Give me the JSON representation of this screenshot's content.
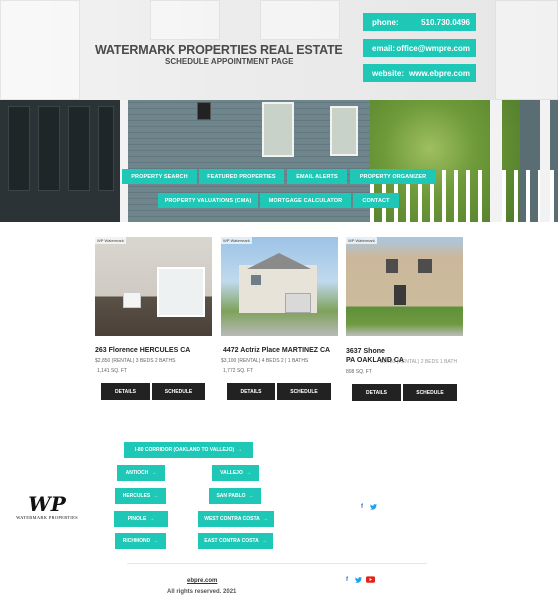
{
  "header": {
    "title": "WATERMARK PROPERTIES REAL ESTATE",
    "subtitle": "SCHEDULE APPOINTMENT PAGE",
    "phone_label": "phone:",
    "phone_value": "510.730.0496",
    "email_label": "email:",
    "email_value": "office@wmpre.com",
    "website_label": "website:",
    "website_value": "www.ebpre.com"
  },
  "nav": {
    "items": [
      "PROPERTY SEARCH",
      "FEATURED PROPERTIES",
      "EMAIL ALERTS",
      "PROPERTY ORGANIZER",
      "PROPERTY VALUATIONS (CMA)",
      "MORTGAGE CALCULATOR",
      "CONTACT"
    ]
  },
  "listings": [
    {
      "logo_text": "WP Watermark",
      "address": "263 Florence HERCULES CA",
      "details_line": "$2,850 (RENTAL) 3 BEDS 2 BATHS",
      "sqft": "1,141 SQ. FT",
      "details_label": "DETAILS",
      "schedule_label": "SCHEDULE"
    },
    {
      "logo_text": "WP Watermark",
      "address": "4472 Actriz Place MARTINEZ CA",
      "details_line": "$3,100 (RENTAL) 4 BEDS 2 | 1 BATHS",
      "sqft": "1,772 SQ. FT",
      "details_label": "DETAILS",
      "schedule_label": "SCHEDULE"
    },
    {
      "logo_text": "WP Watermark",
      "address_line1": "3637 Shone",
      "address_line2": "PA OAKLAND CA",
      "details_line": "$1,750 (RENTAL) 2 BEDS 1 BATH",
      "sqft": "808 SQ. FT",
      "details_label": "DETAILS",
      "schedule_label": "SCHEDULE"
    }
  ],
  "links": {
    "corridor": "I-80 CORRIDOR (OAKLAND TO VALLEJO)",
    "antioch": "ANTIOCH",
    "vallejo": "VALLEJO",
    "hercules": "HERCULES",
    "san_pablo": "SAN PABLO",
    "pinole": "PINOLE",
    "west_contra_costa": "WEST CONTRA COSTA",
    "richmond": "RICHMOND",
    "east_contra_costa": "EAST CONTRA COSTA",
    "arrow": "→"
  },
  "brand": {
    "mark": "WP",
    "name": "WATERMARK PROPERTIES"
  },
  "social": {
    "facebook": "f",
    "twitter": "🐦",
    "youtube": "▶"
  },
  "footer": {
    "link": "ebpre.com",
    "copyright": "All rights reserved. 2021"
  },
  "colors": {
    "accent": "#1fc7b6",
    "dark_button": "#222222"
  }
}
